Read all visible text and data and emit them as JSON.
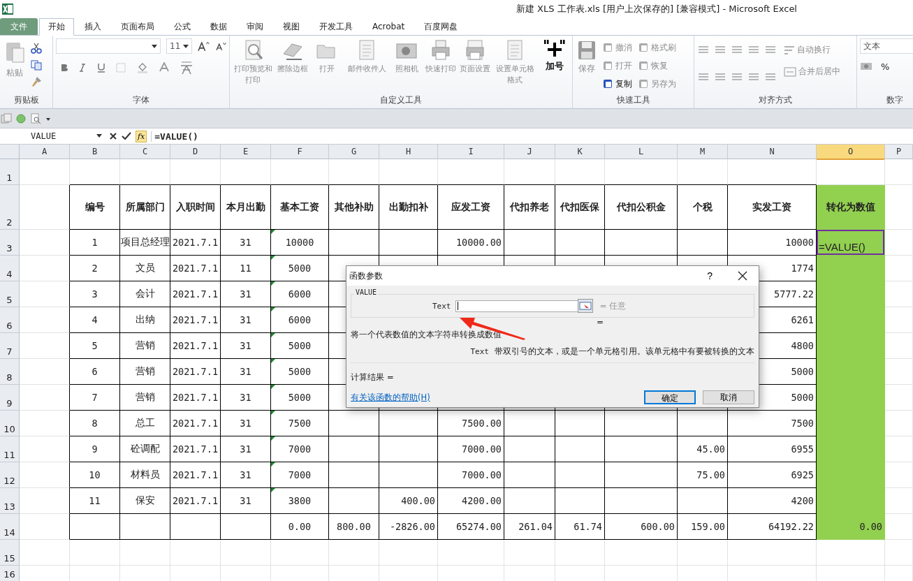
{
  "window": {
    "title": "新建 XLS 工作表.xls [用户上次保存的]  [兼容模式]  -  Microsoft Excel"
  },
  "tabs": [
    {
      "label": "文件",
      "kind": "file",
      "selected": false
    },
    {
      "label": "开始",
      "kind": "tab",
      "selected": true
    },
    {
      "label": "插入",
      "kind": "tab",
      "selected": false
    },
    {
      "label": "页面布局",
      "kind": "tab",
      "selected": false
    },
    {
      "label": "公式",
      "kind": "tab",
      "selected": false
    },
    {
      "label": "数据",
      "kind": "tab",
      "selected": false
    },
    {
      "label": "审阅",
      "kind": "tab",
      "selected": false
    },
    {
      "label": "视图",
      "kind": "tab",
      "selected": false
    },
    {
      "label": "开发工具",
      "kind": "tab",
      "selected": false
    },
    {
      "label": "Acrobat",
      "kind": "tab",
      "selected": false
    },
    {
      "label": "百度网盘",
      "kind": "tab",
      "selected": false
    }
  ],
  "ribbon": {
    "clipboard": {
      "label": "剪贴板",
      "paste": "粘贴"
    },
    "font": {
      "label": "字体",
      "size": "11"
    },
    "custom": {
      "label": "自定义工具",
      "buttons": [
        {
          "label": "打印预览和打印",
          "disabled": true
        },
        {
          "label": "擦除边框",
          "disabled": true
        },
        {
          "label": "打开",
          "disabled": true
        },
        {
          "label": "邮件收件人",
          "disabled": true
        },
        {
          "label": "照相机",
          "disabled": true
        },
        {
          "label": "快速打印",
          "disabled": true
        },
        {
          "label": "页面设置",
          "disabled": true
        },
        {
          "label": "设置单元格格式",
          "disabled": true
        },
        {
          "label": "加号",
          "disabled": false
        }
      ]
    },
    "quick": {
      "label": "快速工具",
      "save": {
        "label": "保存",
        "disabled": true
      },
      "buttons": [
        {
          "label": "撤消",
          "disabled": true
        },
        {
          "label": "格式刷",
          "disabled": true
        },
        {
          "label": "打开",
          "disabled": true
        },
        {
          "label": "恢复",
          "disabled": true
        },
        {
          "label": "复制",
          "disabled": false
        },
        {
          "label": "另存为",
          "disabled": true
        }
      ]
    },
    "alignment": {
      "label": "对齐方式",
      "wrap": "自动换行",
      "merge": "合并后居中"
    },
    "number": {
      "label": "数字",
      "format": "文本",
      "percent": "%"
    }
  },
  "formula_bar": {
    "name_box": "VALUE",
    "insert_function": "fx",
    "formula": "=VALUE()"
  },
  "columns": [
    {
      "label": "A",
      "selected": false
    },
    {
      "label": "B",
      "selected": false
    },
    {
      "label": "C",
      "selected": false
    },
    {
      "label": "D",
      "selected": false
    },
    {
      "label": "E",
      "selected": false
    },
    {
      "label": "F",
      "selected": false
    },
    {
      "label": "G",
      "selected": false
    },
    {
      "label": "H",
      "selected": false
    },
    {
      "label": "I",
      "selected": false
    },
    {
      "label": "J",
      "selected": false
    },
    {
      "label": "K",
      "selected": false
    },
    {
      "label": "L",
      "selected": false
    },
    {
      "label": "M",
      "selected": false
    },
    {
      "label": "N",
      "selected": false
    },
    {
      "label": "O",
      "selected": true
    },
    {
      "label": "P",
      "selected": false
    }
  ],
  "rows": [
    {
      "number": "1",
      "kind": "blank",
      "active": false,
      "flagged": false,
      "cells": {}
    },
    {
      "number": "2",
      "kind": "header",
      "active": false,
      "flagged": false,
      "cells": {
        "B": "编号",
        "C": "所属部门",
        "D": "入职时间",
        "E": "本月出勤",
        "F": "基本工资",
        "G": "其他补助",
        "H": "出勤扣补",
        "I": "应发工资",
        "J": "代扣养老",
        "K": "代扣医保",
        "L": "代扣公积金",
        "M": "个税",
        "N": "实发工资",
        "O": "转化为数值"
      }
    },
    {
      "number": "3",
      "kind": "data",
      "active": true,
      "flagged": true,
      "cells": {
        "B": "1",
        "C": "项目总经理",
        "D": "2021.7.1",
        "E": "31",
        "F": "10000",
        "I": "10000.00",
        "N": "10000",
        "O": "=VALUE()"
      }
    },
    {
      "number": "4",
      "kind": "data",
      "active": false,
      "flagged": true,
      "cells": {
        "B": "2",
        "C": "文员",
        "D": "2021.7.1",
        "E": "11",
        "F": "5000",
        "N": "1774"
      }
    },
    {
      "number": "5",
      "kind": "data",
      "active": false,
      "flagged": true,
      "cells": {
        "B": "3",
        "C": "会计",
        "D": "2021.7.1",
        "E": "31",
        "F": "6000",
        "N": "5777.22"
      }
    },
    {
      "number": "6",
      "kind": "data",
      "active": false,
      "flagged": true,
      "cells": {
        "B": "4",
        "C": "出纳",
        "D": "2021.7.1",
        "E": "31",
        "F": "6000",
        "N": "6261"
      }
    },
    {
      "number": "7",
      "kind": "data",
      "active": false,
      "flagged": true,
      "cells": {
        "B": "5",
        "C": "营销",
        "D": "2021.7.1",
        "E": "31",
        "F": "5000",
        "N": "4800"
      }
    },
    {
      "number": "8",
      "kind": "data",
      "active": false,
      "flagged": true,
      "cells": {
        "B": "6",
        "C": "营销",
        "D": "2021.7.1",
        "E": "31",
        "F": "5000",
        "N": "5000"
      }
    },
    {
      "number": "9",
      "kind": "data",
      "active": false,
      "flagged": true,
      "cells": {
        "B": "7",
        "C": "营销",
        "D": "2021.7.1",
        "E": "31",
        "F": "5000",
        "N": "5000"
      }
    },
    {
      "number": "10",
      "kind": "data",
      "active": false,
      "flagged": true,
      "cells": {
        "B": "8",
        "C": "总工",
        "D": "2021.7.1",
        "E": "31",
        "F": "7500",
        "I": "7500.00",
        "N": "7500"
      }
    },
    {
      "number": "11",
      "kind": "data",
      "active": false,
      "flagged": true,
      "cells": {
        "B": "9",
        "C": "砼调配",
        "D": "2021.7.1",
        "E": "31",
        "F": "7000",
        "I": "7000.00",
        "M": "45.00",
        "N": "6955"
      }
    },
    {
      "number": "12",
      "kind": "data",
      "active": false,
      "flagged": true,
      "cells": {
        "B": "10",
        "C": "材料员",
        "D": "2021.7.1",
        "E": "31",
        "F": "7000",
        "I": "7000.00",
        "M": "75.00",
        "N": "6925"
      }
    },
    {
      "number": "13",
      "kind": "data",
      "active": false,
      "flagged": true,
      "cells": {
        "B": "11",
        "C": "保安",
        "D": "2021.7.1",
        "E": "31",
        "F": "3800",
        "H": "400.00",
        "I": "4200.00",
        "N": "4200"
      }
    },
    {
      "number": "14",
      "kind": "data",
      "active": false,
      "flagged": false,
      "cells": {
        "F": "0.00",
        "G": "800.00",
        "H": "-2826.00",
        "I": "65274.00",
        "J": "261.04",
        "K": "61.74",
        "L": "600.00",
        "M": "159.00",
        "N": "64192.22",
        "O": "0.00"
      }
    },
    {
      "number": "15",
      "kind": "blank",
      "active": false,
      "flagged": false,
      "cells": {}
    },
    {
      "number": "16",
      "kind": "blank",
      "active": false,
      "flagged": false,
      "cells": {}
    }
  ],
  "dialog": {
    "title": "函数参数",
    "help": "?",
    "function_name": "VALUE",
    "arg_label": "Text",
    "arg_result": "= 任意",
    "formula_result": "=",
    "description": "将一个代表数值的文本字符串转换成数值",
    "arg_help_label": "Text",
    "arg_help": "带双引号的文本，或是一个单元格引用。该单元格中有要被转换的文本",
    "result_label": "计算结果 =",
    "help_link": "有关该函数的帮助(H)",
    "buttons": [
      {
        "label": "确定",
        "default": true
      },
      {
        "label": "取消",
        "default": false
      }
    ]
  }
}
